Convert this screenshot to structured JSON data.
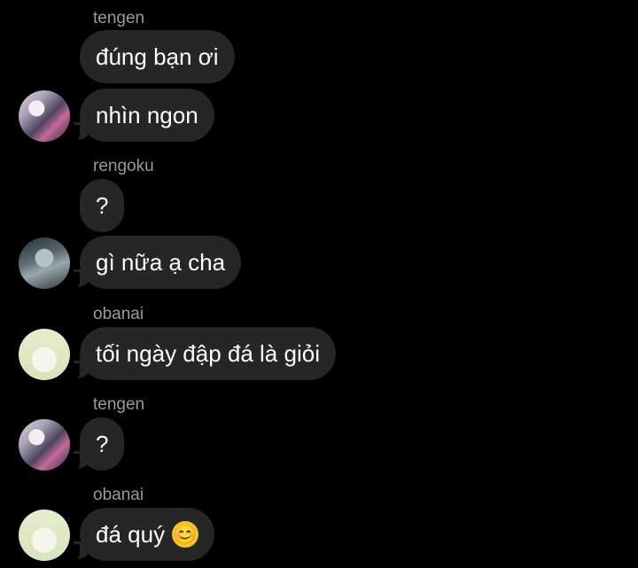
{
  "messages": [
    {
      "sender": "tengen",
      "text": "đúng bạn ơi"
    },
    {
      "text": "nhìn ngon"
    },
    {
      "sender": "rengoku",
      "text": "?"
    },
    {
      "text": "gì nữa ạ cha"
    },
    {
      "sender": "obanai",
      "text": "tối ngày đập đá là giỏi"
    },
    {
      "sender": "tengen",
      "text": "?"
    },
    {
      "sender": "obanai",
      "text": "đá quý",
      "emoji": "😊"
    }
  ],
  "avatars": {
    "tengen": "tengen-avatar",
    "rengoku": "rengoku-avatar",
    "obanai": "obanai-avatar"
  }
}
